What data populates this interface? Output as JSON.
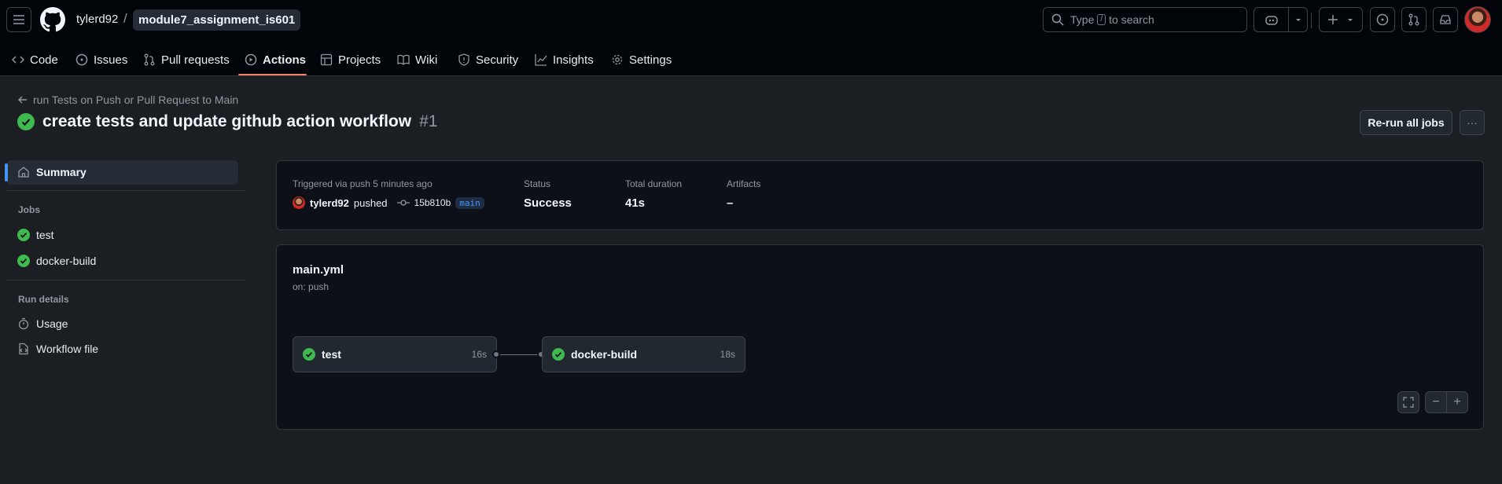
{
  "header": {
    "owner": "tylerd92",
    "slash": "/",
    "repo": "module7_assignment_is601",
    "search_pre": "Type",
    "search_kbd": "/",
    "search_post": "to search"
  },
  "tabs": [
    {
      "label": "Code"
    },
    {
      "label": "Issues"
    },
    {
      "label": "Pull requests"
    },
    {
      "label": "Actions"
    },
    {
      "label": "Projects"
    },
    {
      "label": "Wiki"
    },
    {
      "label": "Security"
    },
    {
      "label": "Insights"
    },
    {
      "label": "Settings"
    }
  ],
  "run": {
    "back_label": "run Tests on Push or Pull Request to Main",
    "title": "create tests and update github action workflow",
    "number": "#1",
    "rerun_label": "Re-run all jobs",
    "more_label": "···"
  },
  "sidebar": {
    "summary": "Summary",
    "jobs_heading": "Jobs",
    "jobs": [
      {
        "label": "test"
      },
      {
        "label": "docker-build"
      }
    ],
    "run_details_heading": "Run details",
    "usage": "Usage",
    "workflow_file": "Workflow file"
  },
  "summary": {
    "trigger_label": "Triggered via push 5 minutes ago",
    "actor": "tylerd92",
    "action": "pushed",
    "commit": "15b810b",
    "branch": "main",
    "status_label": "Status",
    "status_value": "Success",
    "duration_label": "Total duration",
    "duration_value": "41s",
    "artifacts_label": "Artifacts",
    "artifacts_value": "–"
  },
  "workflow": {
    "file": "main.yml",
    "trigger": "on: push",
    "jobs": [
      {
        "name": "test",
        "duration": "16s"
      },
      {
        "name": "docker-build",
        "duration": "18s"
      }
    ],
    "zoom_out": "−",
    "zoom_in": "+"
  },
  "colors": {
    "success": "#3fb950",
    "accent": "#f78166",
    "selected_bar": "#4493f8"
  }
}
